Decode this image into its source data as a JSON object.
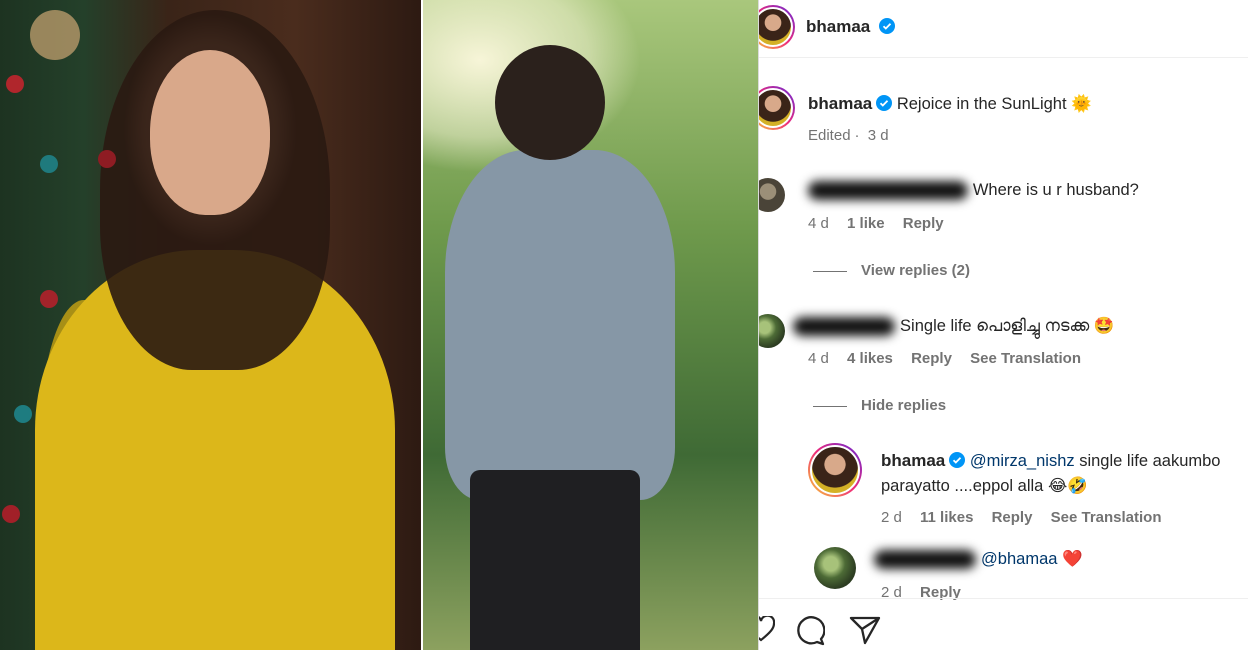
{
  "post": {
    "username": "bhamaa",
    "caption": "Rejoice in the SunLight",
    "caption_emoji": "🌞",
    "edited": "Edited",
    "time": "3 d"
  },
  "comments": [
    {
      "username": "mahesha4mahesha",
      "text": "Where is u r husband?",
      "time": "4 d",
      "likes": "1 like",
      "reply": "Reply",
      "replies_toggle": "View replies (2)"
    },
    {
      "username": "mirza_nishz",
      "text": "Single life പൊളിച്ചു നടക്ക",
      "emoji": "🤩",
      "time": "4 d",
      "likes": "4 likes",
      "reply": "Reply",
      "translation": "See Translation",
      "replies_toggle": "Hide replies"
    }
  ],
  "replies": [
    {
      "username": "bhamaa",
      "mention": "@mirza_nishz",
      "text_line1": "single life aakumbo",
      "text_line2": "parayatto ....eppol alla",
      "emoji": "😂🤣",
      "time": "2 d",
      "likes": "11 likes",
      "reply": "Reply",
      "translation": "See Translation"
    },
    {
      "username": "mirza_nishz",
      "mention": "@bhamaa",
      "emoji": "❤️",
      "time": "2 d",
      "reply": "Reply"
    }
  ],
  "icons": {
    "verified": "verified-badge-icon",
    "like": "heart-icon",
    "comment": "comment-icon",
    "share": "share-icon"
  },
  "colors": {
    "verified": "#0095f6",
    "mention": "#00376b",
    "muted": "#737373",
    "heart": "#ed4956"
  }
}
